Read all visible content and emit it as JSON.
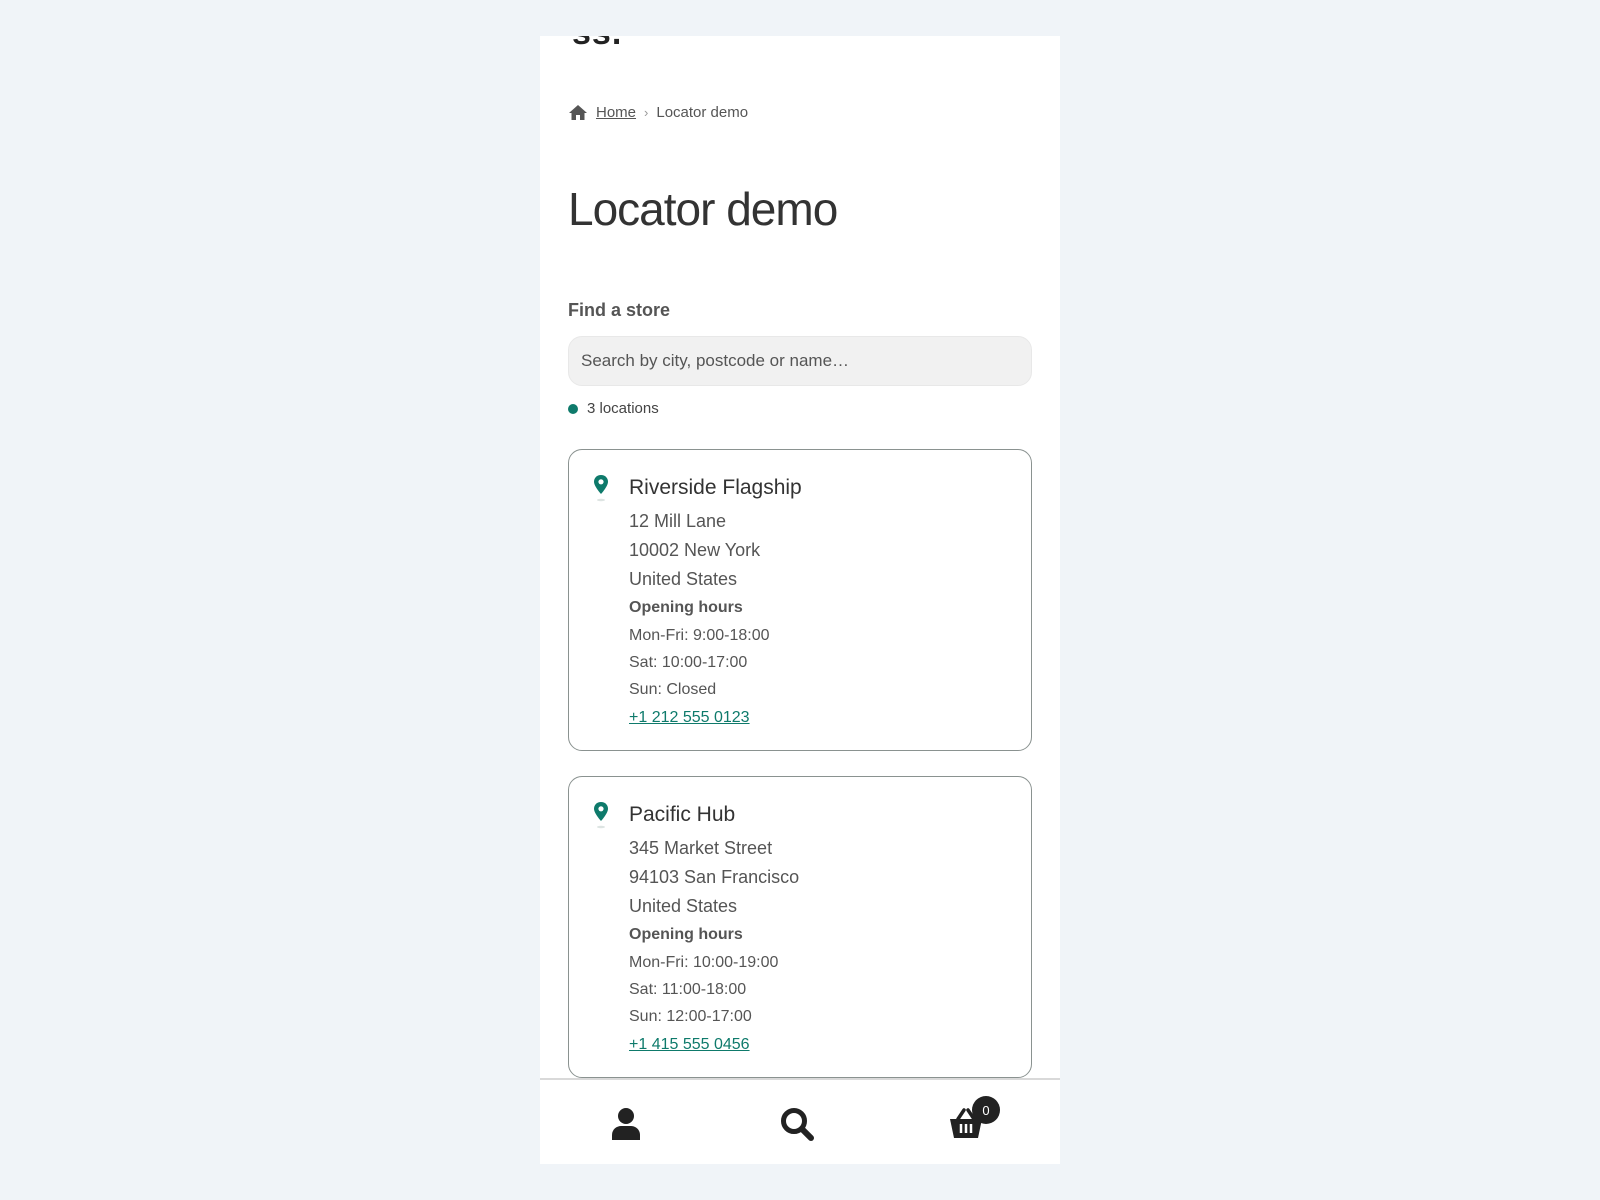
{
  "header": {
    "logo_fragment": "ss."
  },
  "breadcrumb": {
    "home_label": "Home",
    "separator": "›",
    "current": "Locator demo"
  },
  "page": {
    "title": "Locator demo"
  },
  "finder": {
    "label": "Find a store",
    "search_placeholder": "Search by city, postcode or name…",
    "count_text": "3 locations"
  },
  "stores": [
    {
      "name": "Riverside Flagship",
      "address": [
        "12 Mill Lane",
        "10002 New York",
        "United States"
      ],
      "hours_title": "Opening hours",
      "hours": [
        "Mon-Fri: 9:00-18:00",
        "Sat: 10:00-17:00",
        "Sun: Closed"
      ],
      "phone": "+1 212 555 0123"
    },
    {
      "name": "Pacific Hub",
      "address": [
        "345 Market Street",
        "94103 San Francisco",
        "United States"
      ],
      "hours_title": "Opening hours",
      "hours": [
        "Mon-Fri: 10:00-19:00",
        "Sat: 11:00-18:00",
        "Sun: 12:00-17:00"
      ],
      "phone": "+1 415 555 0456"
    }
  ],
  "bottom_bar": {
    "icons": [
      "account-icon",
      "search-icon",
      "cart-icon"
    ],
    "cart_count": "0"
  },
  "colors": {
    "accent": "#0e7a6b",
    "background": "#f0f4f8",
    "panel": "#ffffff"
  }
}
